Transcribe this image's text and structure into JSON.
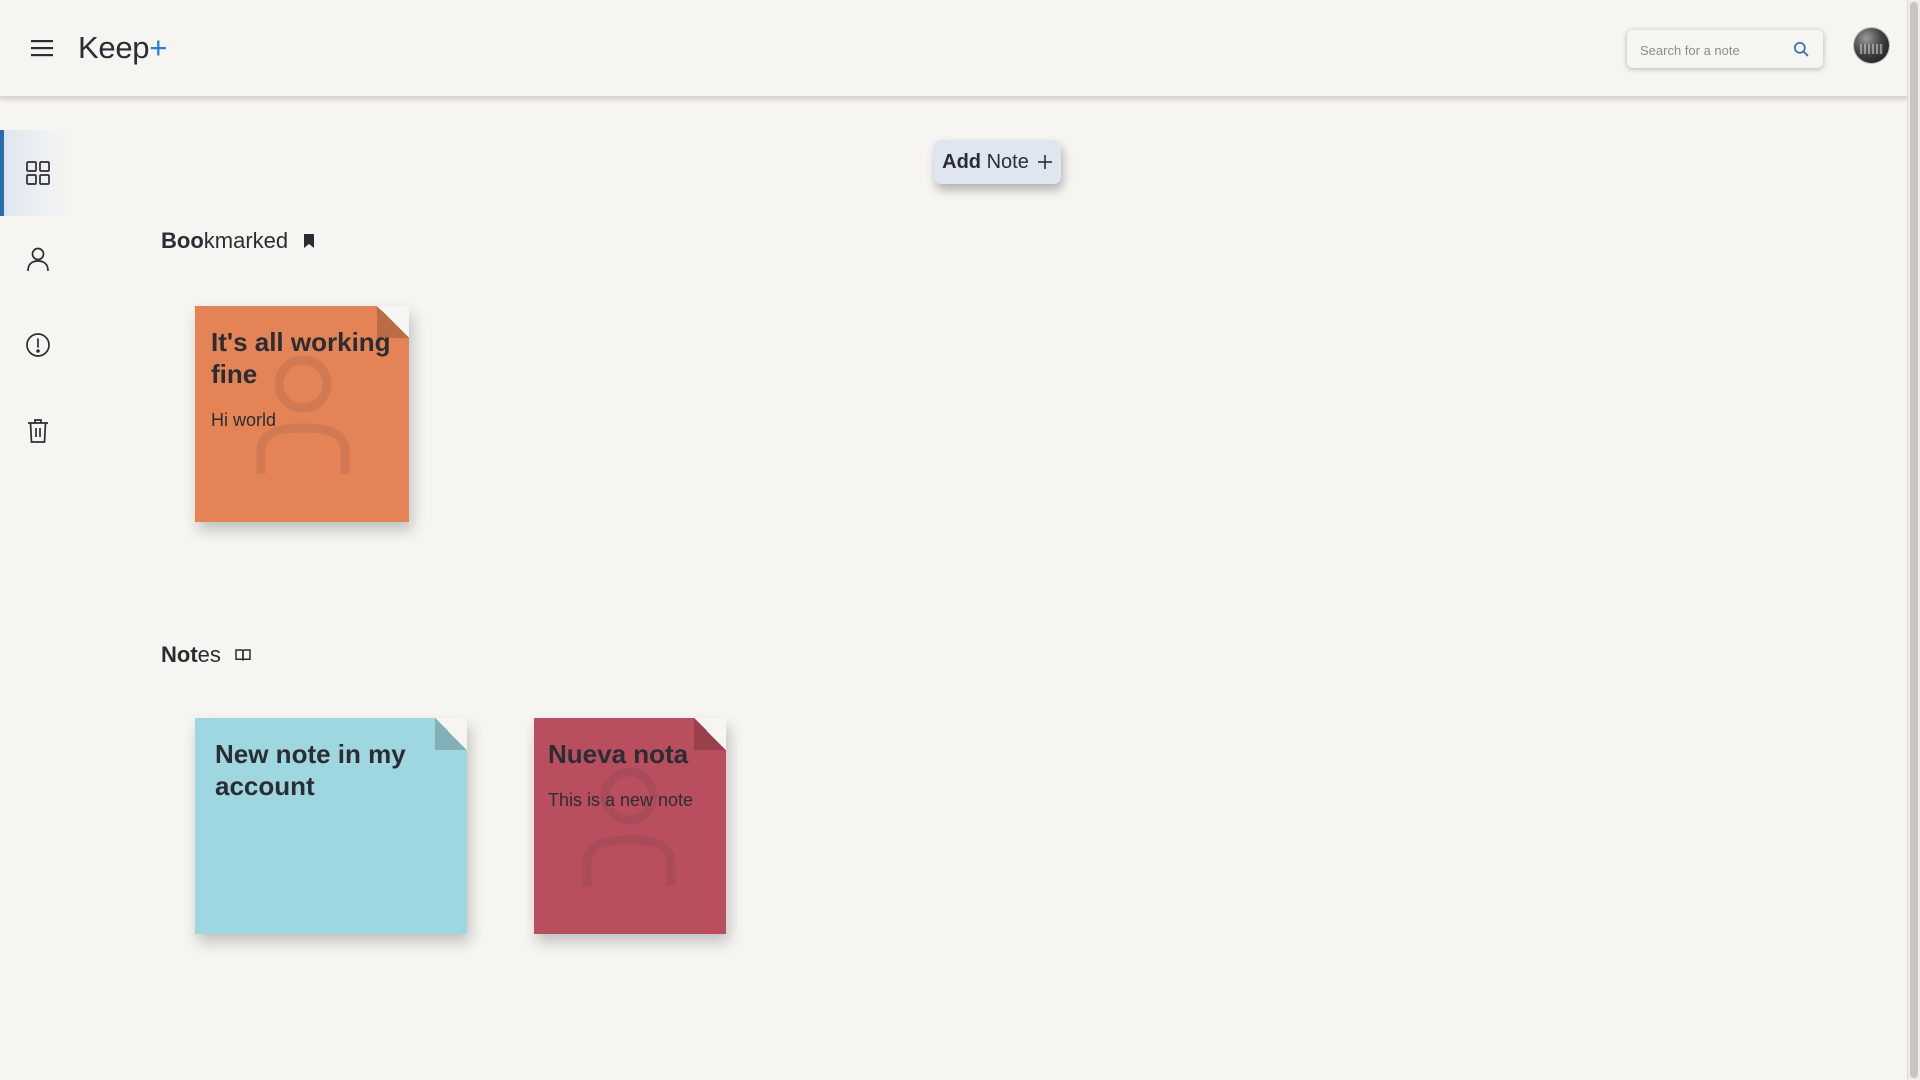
{
  "header": {
    "logo_text": "Keep",
    "logo_plus": "+",
    "search_placeholder": "Search for a note"
  },
  "add_note": {
    "bold": "Add",
    "rest": "Note"
  },
  "sections": {
    "bookmarked": {
      "bold": "Boo",
      "rest": "kmarked"
    },
    "notes": {
      "bold": "Not",
      "rest": "es"
    }
  },
  "bookmarked_notes": [
    {
      "title": "It's all working fine",
      "body": "Hi world",
      "color": "#e48356"
    }
  ],
  "notes": [
    {
      "title": "New note in my account",
      "body": "",
      "color": "#9fd7e0"
    },
    {
      "title": "Nueva nota",
      "body": "This is a new note",
      "color": "#b94f5e"
    }
  ],
  "sidebar_icons": [
    "grid-icon",
    "person-icon",
    "alert-icon",
    "trash-icon"
  ],
  "colors": {
    "accent": "#2b6cb0",
    "background": "#f7f5f1"
  }
}
